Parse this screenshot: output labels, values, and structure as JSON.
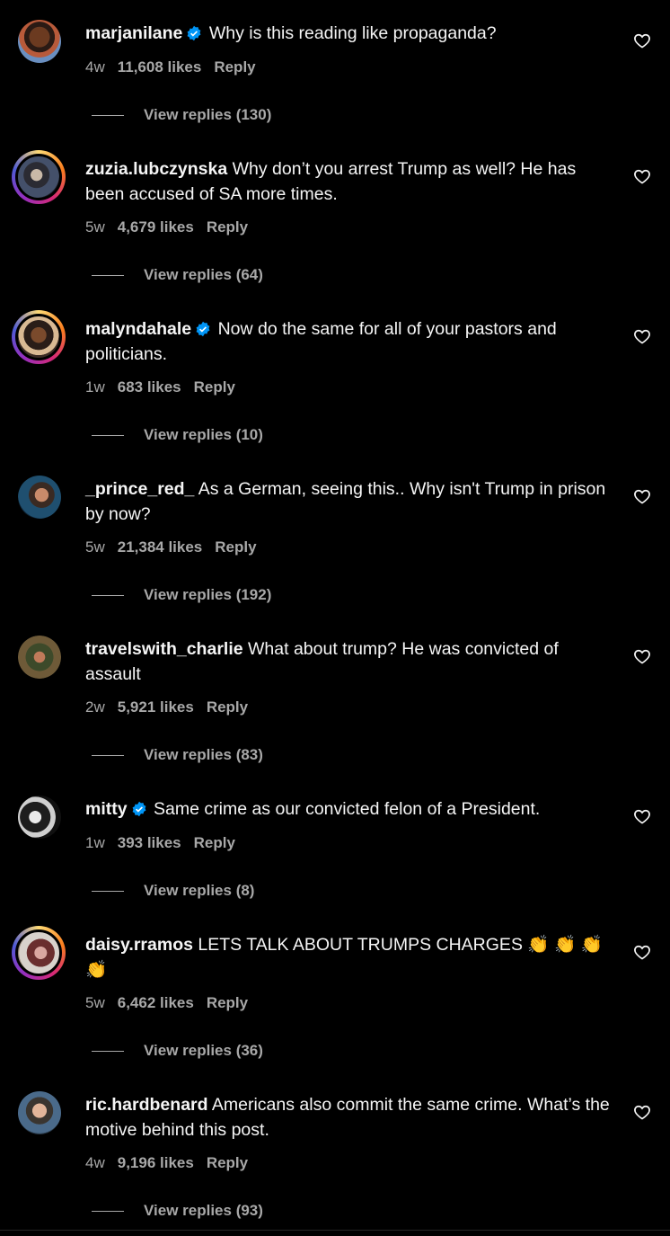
{
  "comments": [
    {
      "username": "marjanilane",
      "verified": true,
      "text": "Why is this reading like propaganda?",
      "age": "4w",
      "likes": "11,608 likes",
      "reply": "Reply",
      "view_replies": "View replies (130)"
    },
    {
      "username": "zuzia.lubczynska",
      "verified": false,
      "text": "Why don’t you arrest Trump as well? He has been accused of SA more times.",
      "age": "5w",
      "likes": "4,679 likes",
      "reply": "Reply",
      "view_replies": "View replies (64)"
    },
    {
      "username": "malyndahale",
      "verified": true,
      "text": "Now do the same for all of your pastors and politicians.",
      "age": "1w",
      "likes": "683 likes",
      "reply": "Reply",
      "view_replies": "View replies (10)"
    },
    {
      "username": "_prince_red_",
      "verified": false,
      "text": "As a German, seeing this.. Why isn't Trump in prison by now?",
      "age": "5w",
      "likes": "21,384 likes",
      "reply": "Reply",
      "view_replies": "View replies (192)"
    },
    {
      "username": "travelswith_charlie",
      "verified": false,
      "text": "What about trump? He was convicted of assault",
      "age": "2w",
      "likes": "5,921 likes",
      "reply": "Reply",
      "view_replies": "View replies (83)"
    },
    {
      "username": "mitty",
      "verified": true,
      "text": "Same crime as our convicted felon of a President.",
      "age": "1w",
      "likes": "393 likes",
      "reply": "Reply",
      "view_replies": "View replies (8)"
    },
    {
      "username": "daisy.rramos",
      "verified": false,
      "text": "LETS TALK ABOUT TRUMPS CHARGES 👏 👏 👏 👏",
      "age": "5w",
      "likes": "6,462 likes",
      "reply": "Reply",
      "view_replies": "View replies (36)"
    },
    {
      "username": "ric.hardbenard",
      "verified": false,
      "text": "Americans also commit the same crime. What’s the motive behind this post.",
      "age": "4w",
      "likes": "9,196 likes",
      "reply": "Reply",
      "view_replies": "View replies (93)"
    }
  ],
  "colors": {
    "background": "#000000",
    "text": "#f5f5f5",
    "secondary": "#a8a8a8",
    "verified": "#0095f6"
  },
  "icons": {
    "like": "heart-outline-icon",
    "verified": "verified-badge-icon"
  }
}
